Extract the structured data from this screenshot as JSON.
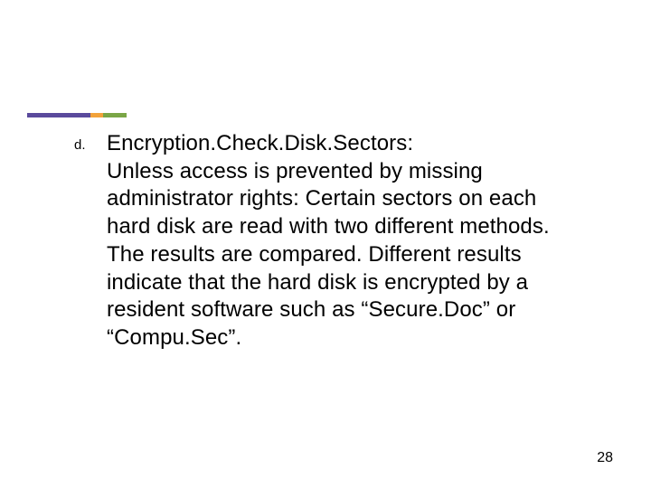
{
  "accent": {
    "colors": [
      "#5a4a9c",
      "#f2a23a",
      "#7aa646"
    ]
  },
  "list": {
    "marker": "d.",
    "title": "Encryption.Check.Disk.Sectors:",
    "body": "Unless access is prevented by missing administrator rights: Certain sectors on each hard disk are read with two different methods. The results are compared. Different results indicate that the hard disk is encrypted by a resident software such as “Secure.Doc” or “Compu.Sec”."
  },
  "page_number": "28"
}
